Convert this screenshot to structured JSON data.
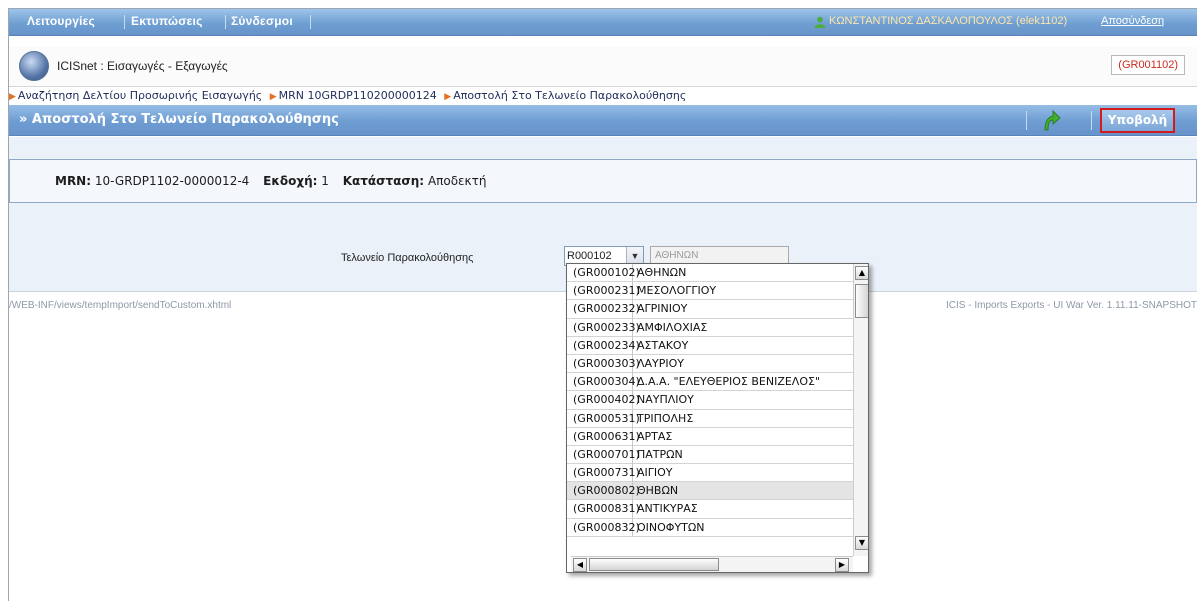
{
  "menubar": {
    "items": [
      "Λειτουργίες",
      "Εκτυπώσεις",
      "Σύνδεσμοι"
    ],
    "user": "ΚΩΝΣΤΑΝΤΙΝΟΣ ΔΑΣΚΑΛΟΠΟΥΛΟΣ (elek1102)",
    "logout": "Αποσύνδεση",
    "user_icon": "user-icon"
  },
  "app": {
    "title": "ICISnet : Εισαγωγές - Εξαγωγές",
    "office_code": "(GR001102)",
    "logo_icon": "globe-logo-icon"
  },
  "breadcrumb": [
    "Αναζήτηση Δελτίου Προσωρινής Εισαγωγής",
    "MRN 10GRDP110200000124",
    "Αποστολή Στο Τελωνείο Παρακολούθησης"
  ],
  "page": {
    "title": "» Αποστολή Στο Τελωνείο Παρακολούθησης",
    "submit_label": "Υποβολή",
    "go_icon": "green-arrow-icon"
  },
  "declaration": {
    "mrn_label": "MRN:",
    "mrn_value": "10-GRDP1102-0000012-4",
    "version_label": "Εκδοχή:",
    "version_value": "1",
    "status_label": "Κατάσταση:",
    "status_value": "Αποδεκτή"
  },
  "form": {
    "office_label": "Τελωνείο Παρακολούθησης",
    "select_value": "R000102",
    "office_name": "ΑΘΗΝΩΝ"
  },
  "dropdown": {
    "options": [
      {
        "code": "(GR000102)",
        "name": "ΑΘΗΝΩΝ"
      },
      {
        "code": "(GR000231)",
        "name": "ΜΕΣΟΛΟΓΓΙΟΥ"
      },
      {
        "code": "(GR000232)",
        "name": "ΑΓΡΙΝΙΟΥ"
      },
      {
        "code": "(GR000233)",
        "name": "ΑΜΦΙΛΟΧΙΑΣ"
      },
      {
        "code": "(GR000234)",
        "name": "ΑΣΤΑΚΟΥ"
      },
      {
        "code": "(GR000303)",
        "name": "ΛΑΥΡΙΟΥ"
      },
      {
        "code": "(GR000304)",
        "name": "Δ.Α.Α. \"ΕΛΕΥΘΕΡΙΟΣ ΒΕΝΙΖΕΛΟΣ\""
      },
      {
        "code": "(GR000402)",
        "name": "ΝΑΥΠΛΙΟΥ"
      },
      {
        "code": "(GR000531)",
        "name": "ΤΡΙΠΟΛΗΣ"
      },
      {
        "code": "(GR000631)",
        "name": "ΑΡΤΑΣ"
      },
      {
        "code": "(GR000701)",
        "name": "ΠΑΤΡΩΝ"
      },
      {
        "code": "(GR000731)",
        "name": "ΑΙΓΙΟΥ"
      },
      {
        "code": "(GR000802)",
        "name": "ΘΗΒΩΝ"
      },
      {
        "code": "(GR000831)",
        "name": "ΑΝΤΙΚΥΡΑΣ"
      },
      {
        "code": "(GR000832)",
        "name": "ΟΙΝΟΦΥΤΩΝ"
      }
    ],
    "highlighted_index": 12
  },
  "footer": {
    "path": "/WEB-INF/views/tempImport/sendToCustom.xhtml",
    "version": "ICIS - Imports Exports - UI War Ver. 1.11.11-SNAPSHOT"
  },
  "colors": {
    "bar_blue": "#6f9fd2",
    "accent_red": "#d21c1c",
    "office_code_red": "#cc2a1f",
    "breadcrumb_arrow": "#e77020"
  }
}
